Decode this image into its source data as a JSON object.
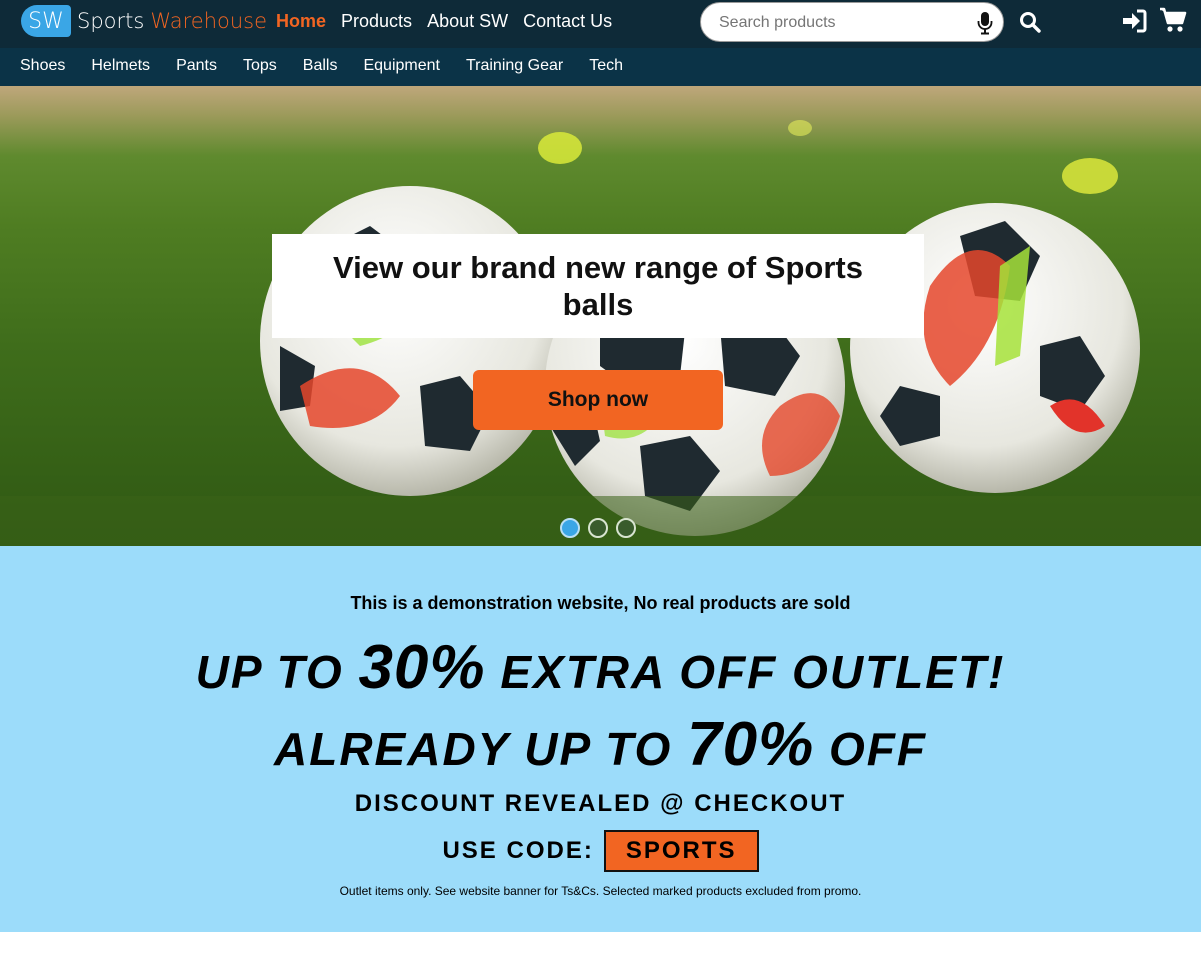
{
  "brand": {
    "badge": "SW",
    "name_part1": "Sports",
    "name_part2": "Warehouse"
  },
  "main_nav": [
    {
      "label": "Home",
      "active": true
    },
    {
      "label": "Products",
      "active": false
    },
    {
      "label": "About SW",
      "active": false
    },
    {
      "label": "Contact Us",
      "active": false
    }
  ],
  "search": {
    "placeholder": "Search products",
    "value": ""
  },
  "icons": {
    "mic": "microphone-icon",
    "search": "search-icon",
    "login": "sign-in-icon",
    "cart": "shopping-cart-icon"
  },
  "categories": [
    "Shoes",
    "Helmets",
    "Pants",
    "Tops",
    "Balls",
    "Equipment",
    "Training Gear",
    "Tech"
  ],
  "hero": {
    "headline": "View our brand new range of Sports balls",
    "button_label": "Shop now",
    "slide_count": 3,
    "active_slide": 1
  },
  "promo": {
    "demo_notice": "This is a demonstration website, No real products are sold",
    "line1_a": "UP TO ",
    "line1_b": "30%",
    "line1_c": " EXTRA OFF OUTLET!",
    "line2_a": "ALREADY UP TO ",
    "line2_b": "70%",
    "line2_c": " OFF",
    "reveal": "DISCOUNT REVEALED @ CHECKOUT",
    "code_label": "USE CODE:",
    "code": "SPORTS",
    "fine_print": "Outlet items only. See website banner for Ts&Cs. Selected marked products excluded from promo."
  },
  "colors": {
    "nav_bg": "#0e2a38",
    "cat_bg": "#0b3347",
    "accent": "#f26522",
    "brand_blue": "#3aa6e6",
    "promo_bg": "#9cdcfa"
  }
}
